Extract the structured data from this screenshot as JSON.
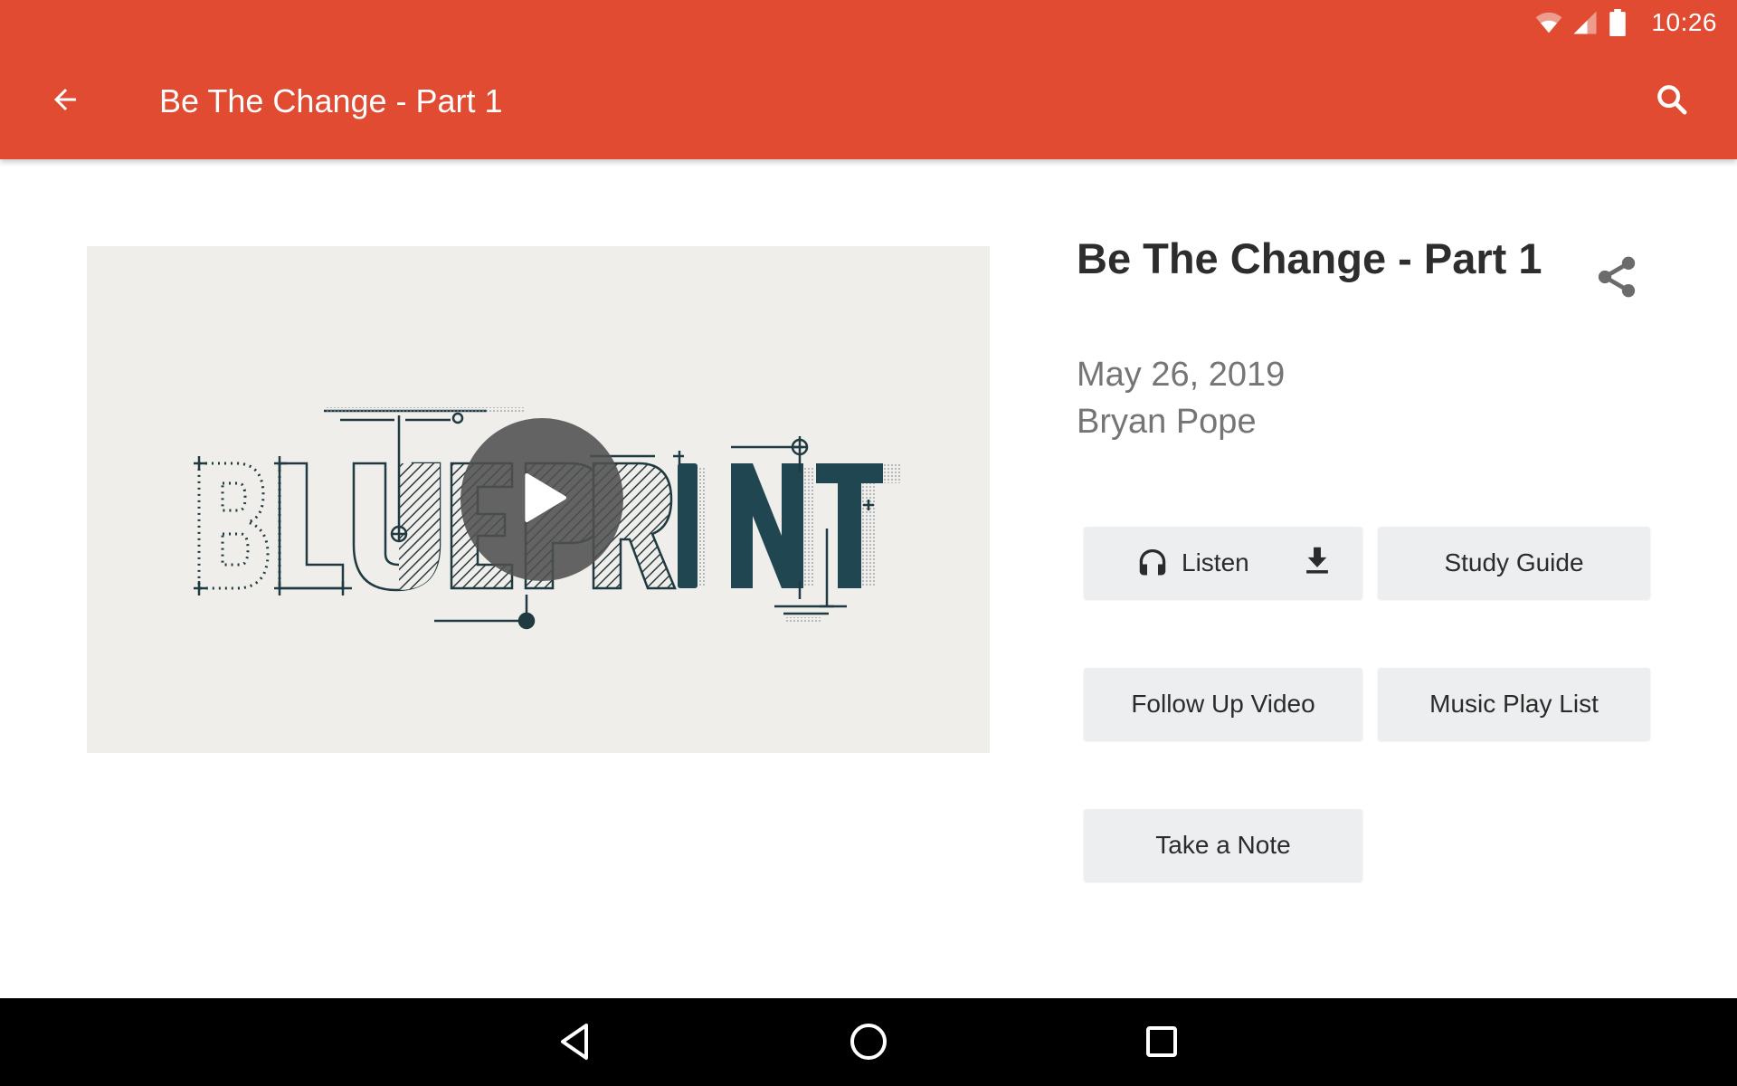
{
  "status_bar": {
    "time": "10:26",
    "icons": [
      "wifi-icon",
      "cell-signal-icon",
      "battery-icon"
    ]
  },
  "app_bar": {
    "back_icon": "arrow-back-icon",
    "title": "Be The Change - Part 1",
    "search_icon": "search-icon",
    "background_color": "#E04B31"
  },
  "media": {
    "thumbnail_text": "BLUEPRINT",
    "play_icon": "play-icon",
    "art_color": "#1F4651"
  },
  "detail": {
    "title": "Be The Change - Part 1",
    "date": "May 26, 2019",
    "speaker": "Bryan Pope",
    "share_icon": "share-icon"
  },
  "actions": {
    "listen": {
      "label": "Listen",
      "icon": "headphones-icon",
      "download_icon": "download-icon"
    },
    "study_guide": {
      "label": "Study Guide"
    },
    "follow_up_video": {
      "label": "Follow Up Video"
    },
    "music_play_list": {
      "label": "Music Play List"
    },
    "take_a_note": {
      "label": "Take a Note"
    }
  },
  "nav_bar": {
    "back": "nav-back-icon",
    "home": "nav-home-icon",
    "recents": "nav-recents-icon"
  }
}
